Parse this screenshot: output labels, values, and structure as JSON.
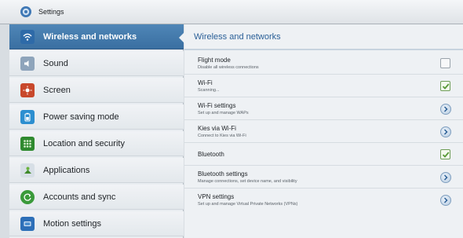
{
  "window": {
    "title": "Settings",
    "icon": "gear-icon"
  },
  "sidebar": {
    "items": [
      {
        "label": "Wireless and networks",
        "icon": "wifi-icon",
        "selected": true
      },
      {
        "label": "Sound",
        "icon": "speaker-icon"
      },
      {
        "label": "Screen",
        "icon": "brightness-icon"
      },
      {
        "label": "Power saving mode",
        "icon": "battery-icon"
      },
      {
        "label": "Location and security",
        "icon": "grid-lock-icon"
      },
      {
        "label": "Applications",
        "icon": "android-icon"
      },
      {
        "label": "Accounts and sync",
        "icon": "sync-icon"
      },
      {
        "label": "Motion settings",
        "icon": "device-motion-icon"
      }
    ]
  },
  "main": {
    "header": "Wireless and networks",
    "rows": [
      {
        "title": "Flight mode",
        "subtitle": "Disable all wireless connections",
        "control": "checkbox",
        "checked": false
      },
      {
        "title": "Wi-Fi",
        "subtitle": "Scanning...",
        "control": "checkbox",
        "checked": true
      },
      {
        "title": "Wi-Fi settings",
        "subtitle": "Set up and manage WAPs",
        "control": "chevron"
      },
      {
        "title": "Kies via Wi-Fi",
        "subtitle": "Connect to Kies via Wi-Fi",
        "control": "chevron"
      },
      {
        "title": "Bluetooth",
        "subtitle": "",
        "control": "checkbox",
        "checked": true
      },
      {
        "title": "Bluetooth settings",
        "subtitle": "Manage connections, set device name, and visibility",
        "control": "chevron"
      },
      {
        "title": "VPN settings",
        "subtitle": "Set up and manage Virtual Private Networks (VPNs)",
        "control": "chevron"
      }
    ]
  },
  "colors": {
    "accent": "#3a6fa1",
    "header_text": "#2a5f97",
    "check_green": "#5a9a3a"
  }
}
